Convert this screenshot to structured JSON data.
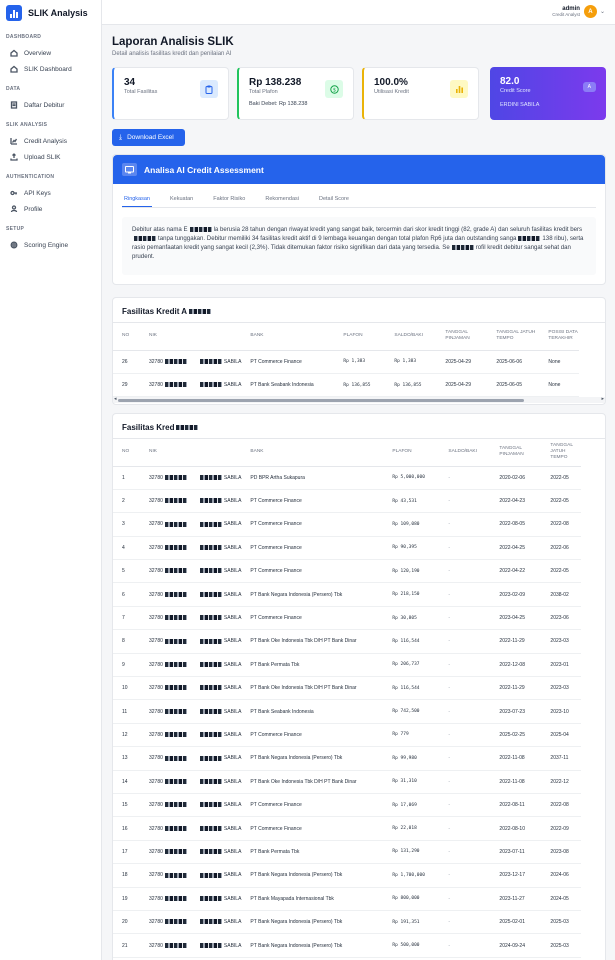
{
  "app": {
    "name": "SLIK Analysis"
  },
  "sidebar": {
    "sections": [
      {
        "title": "DASHBOARD",
        "items": [
          {
            "label": "Overview",
            "icon": "home-icon"
          },
          {
            "label": "SLIK Dashboard",
            "icon": "home-icon"
          }
        ]
      },
      {
        "title": "DATA",
        "items": [
          {
            "label": "Daftar Debitur",
            "icon": "document-icon"
          }
        ]
      },
      {
        "title": "SLIK ANALYSIS",
        "items": [
          {
            "label": "Credit Analysis",
            "icon": "chart-icon"
          },
          {
            "label": "Upload SLIK",
            "icon": "upload-icon"
          }
        ]
      },
      {
        "title": "AUTHENTICATION",
        "items": [
          {
            "label": "API Keys",
            "icon": "key-icon"
          },
          {
            "label": "Profile",
            "icon": "user-icon"
          }
        ]
      },
      {
        "title": "SETUP",
        "items": [
          {
            "label": "Scoring Engine",
            "icon": "gear-icon"
          }
        ]
      }
    ]
  },
  "user": {
    "name": "admin",
    "role": "Credit Analyst",
    "initial": "A"
  },
  "page": {
    "title": "Laporan Analisis SLIK",
    "subtitle": "Detail analisis fasilitas kredit dan penilaian AI"
  },
  "stats": [
    {
      "value": "34",
      "label": "Total Fasilitas",
      "icon": "clipboard-icon",
      "accent": "#3b82f6"
    },
    {
      "value": "Rp 138.238",
      "label": "Total Plafon",
      "extra": "Baki Debet: Rp 138.238",
      "icon": "dollar-icon",
      "accent": "#22c55e"
    },
    {
      "value": "100.0%",
      "label": "Utilisasi Kredit",
      "icon": "bar-chart-icon",
      "accent": "#eab308"
    }
  ],
  "score": {
    "value": "82.0",
    "label": "Credit Score",
    "name": "ERDINI SABILA",
    "grade": "A"
  },
  "download_label": "Download Excel",
  "ai": {
    "title": "Analisa AI Credit Assessment",
    "tabs": [
      "Ringkasan",
      "Kekuatan",
      "Faktor Risiko",
      "Rekomendasi",
      "Detail Score"
    ],
    "active_tab": "Ringkasan",
    "body_1": "Debitur atas nama E",
    "body_2": "la berusia 28 tahun dengan riwayat kredit yang sangat baik, tercermin dari skor kredit tinggi (82, grade A) dan seluruh fasilitas kredit bers",
    "body_3": "tanpa tunggakan. Debitur memiliki 34 fasilitas kredit aktif di 9 lembaga keuangan dengan total plafon Rp6 juta dan outstanding sanga",
    "body_4": "138 ribu), serta rasio pemanfaatan kredit yang sangat kecil (2,3%). Tidak ditemukan faktor risiko signifikan dari data yang tersedia. Se",
    "body_5": "rofil kredit debitur sangat sehat dan prudent."
  },
  "table1": {
    "title": "Fasilitas Kredit A",
    "headers": [
      "NO",
      "NIK",
      "",
      "BANK",
      "PLAFON",
      "SALDO/BAKI",
      "TANGGAL PINJAMAN",
      "TANGGAL JATUH TEMPO",
      "POSISI DATA TERAKHIR"
    ],
    "rows": [
      [
        "26",
        "32780",
        "SABILA",
        "PT Commerce Finance",
        "Rp 1,383",
        "Rp 1,383",
        "2025-04-29",
        "2025-06-06",
        "None"
      ],
      [
        "29",
        "32780",
        "SABILA",
        "PT Bank Seabank Indonesia",
        "Rp 136,855",
        "Rp 136,855",
        "2025-04-29",
        "2025-06-05",
        "None"
      ]
    ]
  },
  "table2": {
    "title": "Fasilitas Kred",
    "headers": [
      "NO",
      "NIK",
      "",
      "BANK",
      "PLAFON",
      "SALDO/BAKI",
      "TANGGAL PINJAMAN",
      "TANGGAL JATUH TEMPO"
    ],
    "rows": [
      [
        "1",
        "32780",
        "SABILA",
        "PD BPR Artha Sukapura",
        "Rp 5,000,000",
        "-",
        "2020-02-06",
        "2022-05"
      ],
      [
        "2",
        "32780",
        "SABILA",
        "PT Commerce Finance",
        "Rp 43,531",
        "-",
        "2022-04-23",
        "2022-05"
      ],
      [
        "3",
        "32780",
        "SABILA",
        "PT Commerce Finance",
        "Rp 109,080",
        "-",
        "2022-08-05",
        "2022-08"
      ],
      [
        "4",
        "32780",
        "SABILA",
        "PT Commerce Finance",
        "Rp 90,395",
        "-",
        "2022-04-25",
        "2022-06"
      ],
      [
        "5",
        "32780",
        "SABILA",
        "PT Commerce Finance",
        "Rp 120,190",
        "-",
        "2022-04-22",
        "2022-05"
      ],
      [
        "6",
        "32780",
        "SABILA",
        "PT Bank Negara Indonesia (Persero) Tbk",
        "Rp 218,150",
        "-",
        "2023-02-09",
        "2038-02"
      ],
      [
        "7",
        "32780",
        "SABILA",
        "PT Commerce Finance",
        "Rp 30,805",
        "-",
        "2023-04-25",
        "2023-06"
      ],
      [
        "8",
        "32780",
        "SABILA",
        "PT Bank Oke Indonesia Tbk D/H PT Bank Dinar",
        "Rp 116,544",
        "-",
        "2022-11-29",
        "2023-03"
      ],
      [
        "9",
        "32780",
        "SABILA",
        "PT Bank Permata Tbk",
        "Rp 206,737",
        "-",
        "2022-12-08",
        "2023-01"
      ],
      [
        "10",
        "32780",
        "SABILA",
        "PT Bank Oke Indonesia Tbk D/H PT Bank Dinar",
        "Rp 116,544",
        "-",
        "2022-11-29",
        "2023-03"
      ],
      [
        "11",
        "32780",
        "SABILA",
        "PT Bank Seabank Indonesia",
        "Rp 742,500",
        "-",
        "2023-07-23",
        "2023-10"
      ],
      [
        "12",
        "32780",
        "SABILA",
        "PT Commerce Finance",
        "Rp 779",
        "-",
        "2025-02-25",
        "2025-04"
      ],
      [
        "13",
        "32780",
        "SABILA",
        "PT Bank Negara Indonesia (Persero) Tbk",
        "Rp 99,980",
        "-",
        "2022-11-08",
        "2037-11"
      ],
      [
        "14",
        "32780",
        "SABILA",
        "PT Bank Oke Indonesia Tbk D/H PT Bank Dinar",
        "Rp 31,310",
        "-",
        "2022-11-08",
        "2022-12"
      ],
      [
        "15",
        "32780",
        "SABILA",
        "PT Commerce Finance",
        "Rp 17,069",
        "-",
        "2022-08-11",
        "2022-08"
      ],
      [
        "16",
        "32780",
        "SABILA",
        "PT Commerce Finance",
        "Rp 22,018",
        "-",
        "2022-08-10",
        "2022-09"
      ],
      [
        "17",
        "32780",
        "SABILA",
        "PT Bank Permata Tbk",
        "Rp 131,290",
        "-",
        "2023-07-11",
        "2023-08"
      ],
      [
        "18",
        "32780",
        "SABILA",
        "PT Bank Negara Indonesia (Persero) Tbk",
        "Rp 1,700,000",
        "-",
        "2023-12-17",
        "2024-06"
      ],
      [
        "19",
        "32780",
        "SABILA",
        "PT Bank Mayapada Internasional Tbk",
        "Rp 800,000",
        "-",
        "2023-11-27",
        "2024-05"
      ],
      [
        "20",
        "32780",
        "SABILA",
        "PT Bank Negara Indonesia (Persero) Tbk",
        "Rp 191,351",
        "-",
        "2025-02-01",
        "2025-03"
      ],
      [
        "21",
        "32780",
        "SABILA",
        "PT Bank Negara Indonesia (Persero) Tbk",
        "Rp 500,000",
        "-",
        "2024-09-24",
        "2025-03"
      ]
    ]
  }
}
